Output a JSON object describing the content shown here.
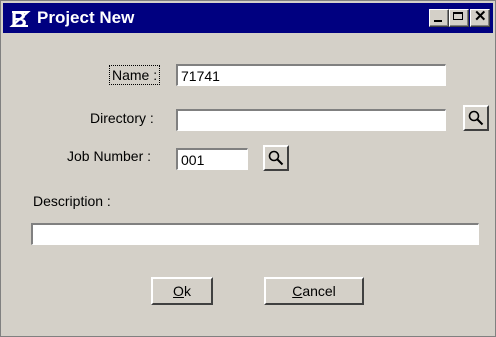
{
  "window": {
    "title": "Project New",
    "icon": "app-logo-icon"
  },
  "titlebar_buttons": {
    "minimize": "minimize-icon",
    "maximize": "maximize-icon",
    "close": "close-icon",
    "close_glyph": "✕"
  },
  "form": {
    "name": {
      "label": "Name :",
      "value": "71741"
    },
    "directory": {
      "label": "Directory :",
      "value": ""
    },
    "job_number": {
      "label": "Job Number :",
      "value": "001"
    },
    "description": {
      "label": "Description :",
      "value": ""
    }
  },
  "buttons": {
    "ok": {
      "accel": "O",
      "rest": "k"
    },
    "cancel": {
      "accel": "C",
      "rest": "ancel"
    }
  }
}
